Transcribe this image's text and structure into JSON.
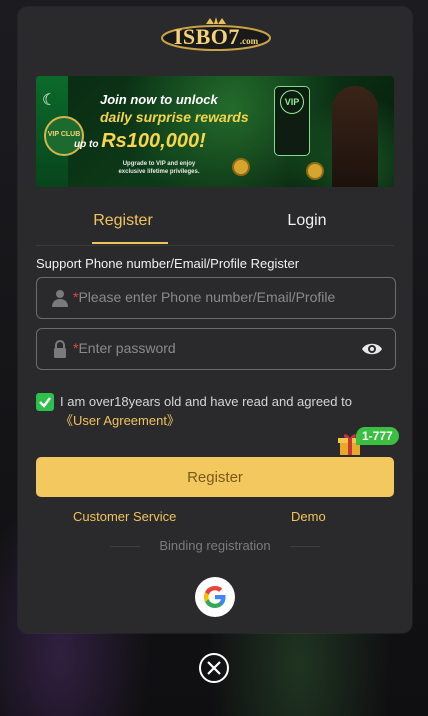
{
  "brand": {
    "logo_text": "ISBO7",
    "logo_suffix": ".com"
  },
  "banner": {
    "line1": "Join now to unlock",
    "line2": "daily surprise rewards",
    "line3_prefix": "up to",
    "line3_amount": "Rs100,000!",
    "line4": "Upgrade to VIP and enjoy exclusive lifetime privileges.",
    "vip_club": "VIP CLUB",
    "vip_badge": "VIP"
  },
  "tabs": [
    {
      "label": "Register",
      "active": true
    },
    {
      "label": "Login",
      "active": false
    }
  ],
  "form": {
    "support_label": "Support Phone number/Email/Profile Register",
    "phone_placeholder": "Please enter Phone number/Email/Profile",
    "password_placeholder": "Enter password",
    "required_mark": "*",
    "agree_text": "I am over18years old and have read and agreed to",
    "agree_link": "《User Agreement》",
    "agree_checked": true,
    "register_button": "Register"
  },
  "bonus_badge": "1-777",
  "links": {
    "customer_service": "Customer Service",
    "demo": "Demo"
  },
  "binding_label": "Binding registration",
  "colors": {
    "accent": "#f0c35c",
    "button": "#f3c85f",
    "checkbox": "#2fbf4f",
    "modal_bg": "#2a2a2c",
    "required": "#e2483d"
  },
  "icons": {
    "phone_field": "user-icon",
    "password_field": "lock-icon",
    "password_toggle": "eye-icon",
    "social_login": "google-icon",
    "close": "close-icon",
    "gift": "gift-icon"
  }
}
